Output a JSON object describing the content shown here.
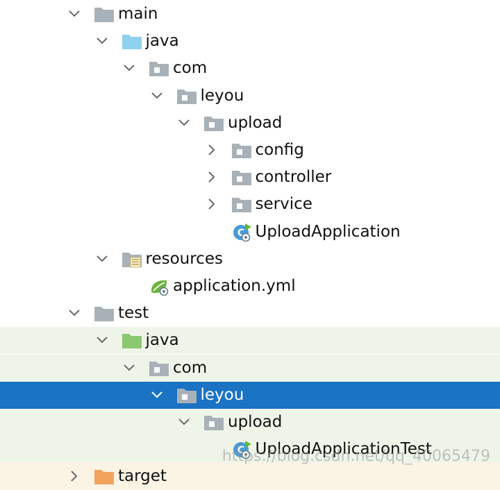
{
  "colors": {
    "folder_gray": "#a9b1b8",
    "folder_blue": "#8fd0ee",
    "folder_green": "#8cc870",
    "folder_orange": "#f2a45f",
    "package_dot": "#ffffff",
    "arrow": "#6a6a6a",
    "arrow_selected": "#ffffff",
    "selected_bg": "#1a73c3",
    "test_bg": "#eef5e8"
  },
  "tree": [
    {
      "label": "main",
      "level": 0,
      "state": "expanded",
      "icon": "folder-gray-icon",
      "variant": "folder-gray"
    },
    {
      "label": "java",
      "level": 1,
      "state": "expanded",
      "icon": "source-folder-icon",
      "variant": "folder-blue"
    },
    {
      "label": "com",
      "level": 2,
      "state": "expanded",
      "icon": "package-icon",
      "variant": "package"
    },
    {
      "label": "leyou",
      "level": 3,
      "state": "expanded",
      "icon": "package-icon",
      "variant": "package"
    },
    {
      "label": "upload",
      "level": 4,
      "state": "expanded",
      "icon": "package-icon",
      "variant": "package"
    },
    {
      "label": "config",
      "level": 5,
      "state": "collapsed",
      "icon": "package-icon",
      "variant": "package"
    },
    {
      "label": "controller",
      "level": 5,
      "state": "collapsed",
      "icon": "package-icon",
      "variant": "package"
    },
    {
      "label": "service",
      "level": 5,
      "state": "collapsed",
      "icon": "package-icon",
      "variant": "package"
    },
    {
      "label": "UploadApplication",
      "level": 5,
      "state": "leaf",
      "icon": "spring-boot-class-icon",
      "variant": "spring-class"
    },
    {
      "label": "resources",
      "level": 1,
      "state": "expanded",
      "icon": "resources-folder-icon",
      "variant": "resources"
    },
    {
      "label": "application.yml",
      "level": 2,
      "state": "leaf",
      "icon": "spring-yml-icon",
      "variant": "spring-yml"
    },
    {
      "label": "test",
      "level": 0,
      "state": "expanded",
      "icon": "folder-gray-icon",
      "variant": "folder-gray"
    },
    {
      "label": "java",
      "level": 1,
      "state": "expanded",
      "icon": "test-source-folder-icon",
      "variant": "folder-green",
      "bg": "test"
    },
    {
      "label": "com",
      "level": 2,
      "state": "expanded",
      "icon": "package-icon",
      "variant": "package",
      "bg": "test"
    },
    {
      "label": "leyou",
      "level": 3,
      "state": "expanded",
      "icon": "package-icon",
      "variant": "package",
      "bg": "selected"
    },
    {
      "label": "upload",
      "level": 4,
      "state": "expanded",
      "icon": "package-icon",
      "variant": "package",
      "bg": "test"
    },
    {
      "label": "UploadApplicationTest",
      "level": 5,
      "state": "leaf",
      "icon": "spring-boot-class-icon",
      "variant": "spring-class",
      "bg": "test"
    },
    {
      "label": "target",
      "level": 0,
      "state": "collapsed",
      "icon": "excluded-folder-icon",
      "variant": "folder-orange",
      "bg": "target"
    }
  ],
  "watermark": "https://blog.csdn.net/qq_40065479"
}
